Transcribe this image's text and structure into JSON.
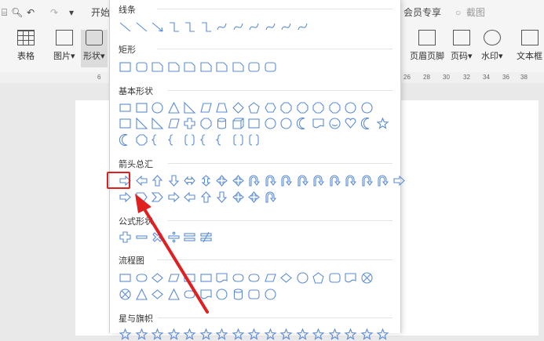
{
  "topbar": {
    "tab_start": "开始",
    "member": "会员专享",
    "search": "截图"
  },
  "ribbon": {
    "table": "表格",
    "picture": "图片",
    "shape": "形状",
    "header_footer": "页眉页脚",
    "page_number": "页码",
    "watermark": "水印",
    "textbox": "文本框"
  },
  "ruler": {
    "left_mark": "6",
    "ticks": [
      "26",
      "28",
      "30",
      "32",
      "34",
      "36",
      "38"
    ]
  },
  "panel": {
    "sections": {
      "lines": "线条",
      "rect": "矩形",
      "basic": "基本形状",
      "arrows": "箭头总汇",
      "formula": "公式形状",
      "flowchart": "流程图",
      "stars": "星与旗帜"
    }
  },
  "colors": {
    "shape_stroke": "#5b8bd6",
    "highlight": "#e02020"
  }
}
